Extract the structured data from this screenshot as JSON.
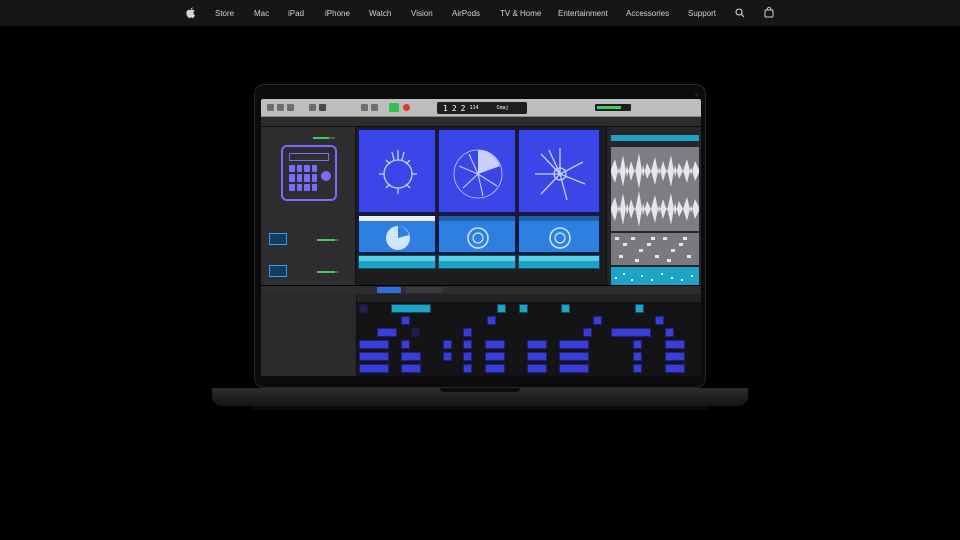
{
  "nav": {
    "items": [
      "Store",
      "Mac",
      "iPad",
      "iPhone",
      "Watch",
      "Vision",
      "AirPods",
      "TV & Home",
      "Entertainment",
      "Accessories",
      "Support"
    ],
    "icons": [
      "apple-logo-icon",
      "search-icon",
      "bag-icon"
    ],
    "bg_color": "#161617",
    "text_color": "#d2d2d7"
  },
  "daw": {
    "lcd": {
      "bar": "1",
      "beat": "2",
      "division": "2",
      "tempo": "114",
      "key": "Cmaj"
    },
    "accent_purple": "#7a6bff",
    "accent_blue": "#3a3ed8",
    "accent_teal": "#1ea3c7"
  }
}
